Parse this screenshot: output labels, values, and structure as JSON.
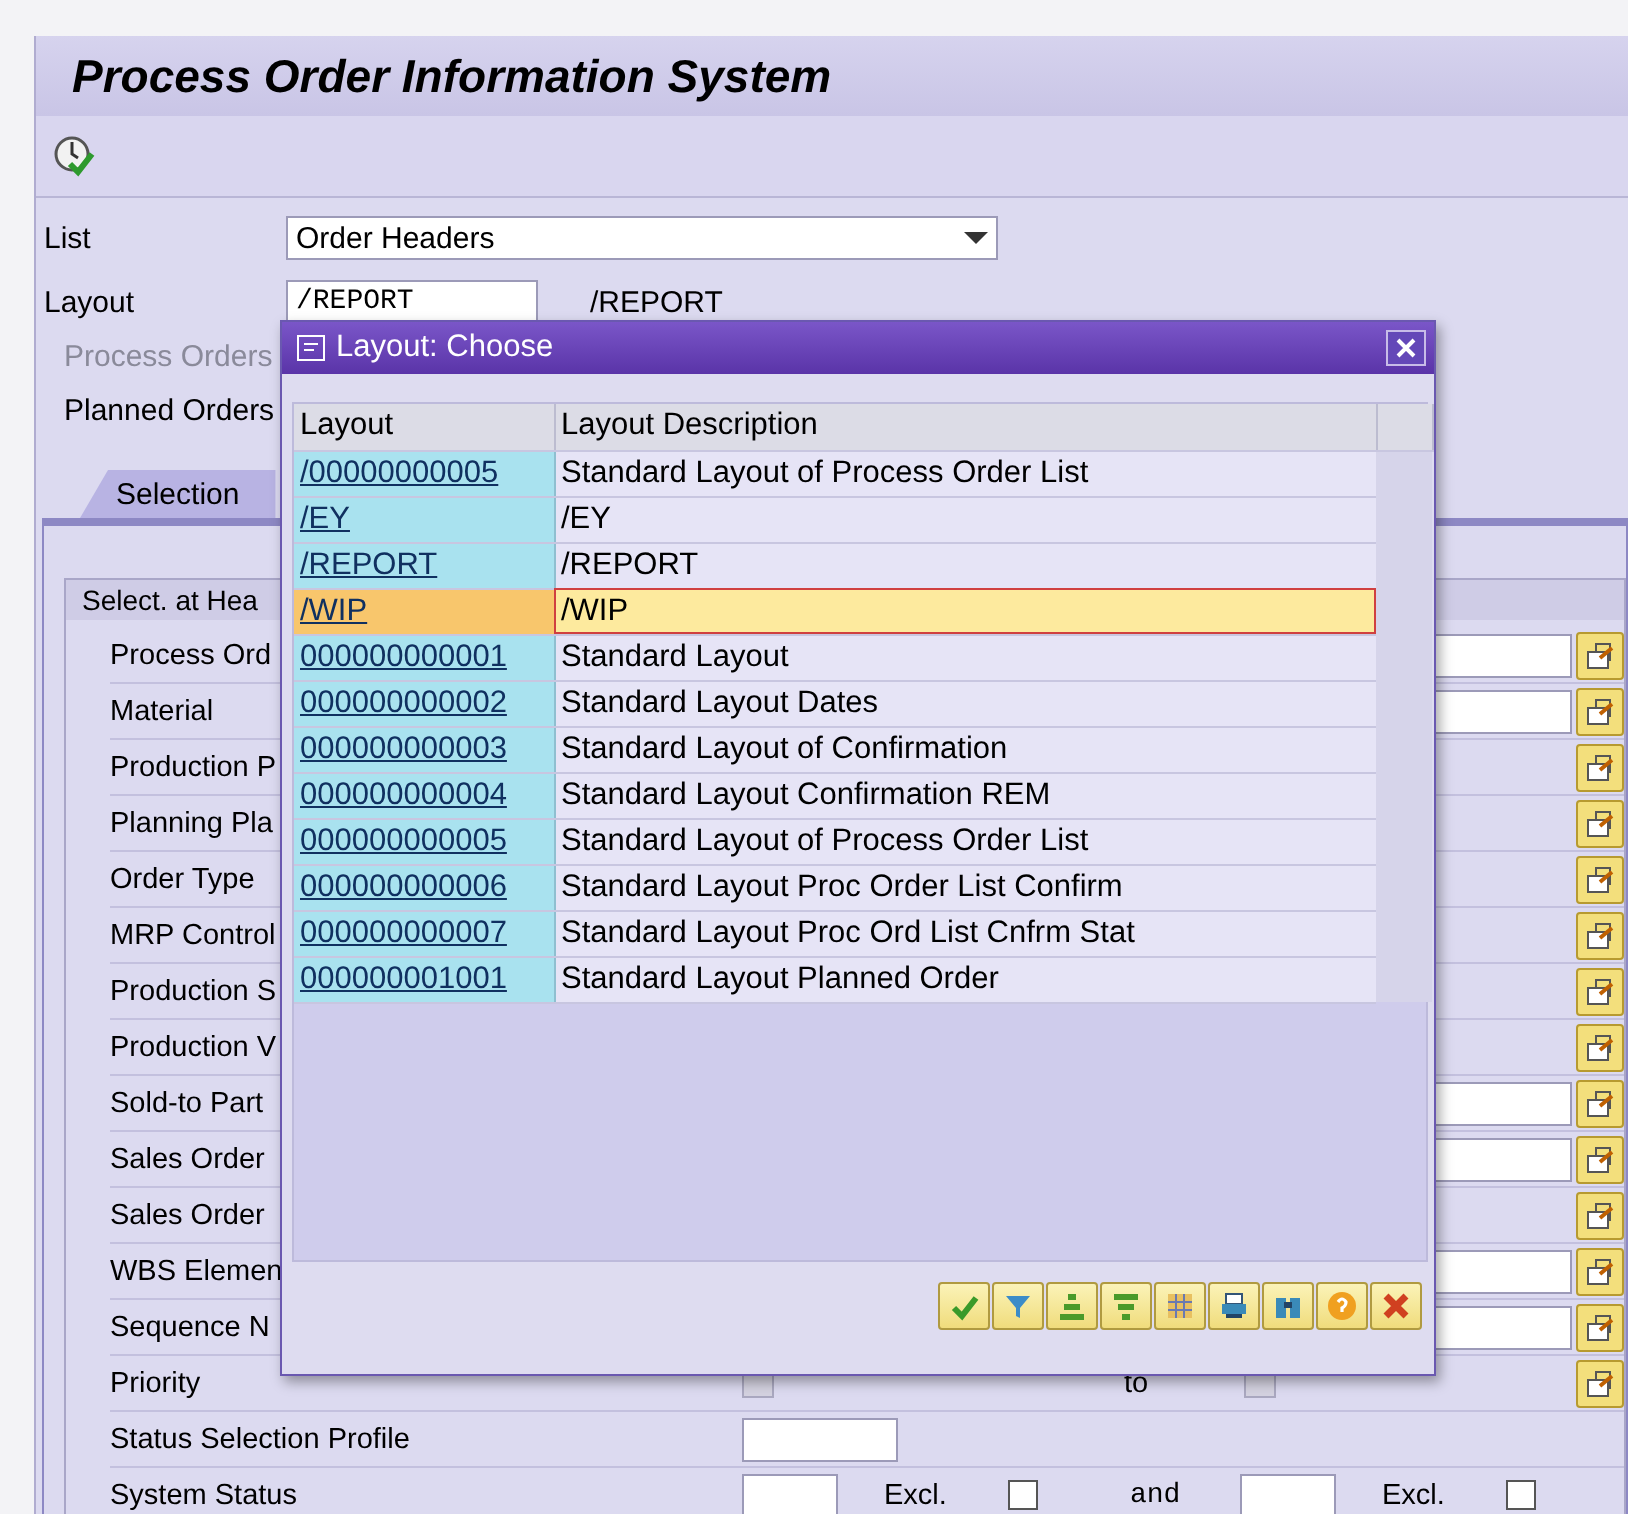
{
  "window": {
    "title": "Process Order Information System"
  },
  "form": {
    "list_label": "List",
    "list_value": "Order Headers",
    "layout_label": "Layout",
    "layout_value": "/REPORT",
    "layout_text": "/REPORT",
    "options": [
      {
        "label": "Process Orders",
        "disabled": true
      },
      {
        "label": "Planned Orders",
        "disabled": false
      }
    ]
  },
  "tabs": [
    {
      "label": "Selection",
      "selected": true
    }
  ],
  "group": {
    "title": "Select. at Hea",
    "rows": [
      {
        "label": "Process Ord",
        "kind": "range",
        "to_field": true
      },
      {
        "label": "Material",
        "kind": "range",
        "to_field": true
      },
      {
        "label": "Production P",
        "kind": "range",
        "to_field": false
      },
      {
        "label": "Planning Pla",
        "kind": "range",
        "to_field": false
      },
      {
        "label": "Order Type",
        "kind": "range",
        "to_field": false
      },
      {
        "label": "MRP Control",
        "kind": "range",
        "to_field": false
      },
      {
        "label": "Production S",
        "kind": "range",
        "to_field": false
      },
      {
        "label": "Production V",
        "kind": "range",
        "to_field": false
      },
      {
        "label": "Sold-to Part",
        "kind": "range",
        "to_field": true
      },
      {
        "label": "Sales Order",
        "kind": "range",
        "to_field": true
      },
      {
        "label": "Sales Order",
        "kind": "range",
        "to_field": false
      },
      {
        "label": "WBS Elemen",
        "kind": "range",
        "to_field": true
      },
      {
        "label": "Sequence N",
        "kind": "range",
        "to_field": true
      },
      {
        "label": "Priority",
        "kind": "priority",
        "to": "to"
      },
      {
        "label": "Status Selection Profile",
        "kind": "profile"
      },
      {
        "label": "System Status",
        "kind": "status",
        "excl1": "Excl.",
        "and": "and",
        "excl2": "Excl.",
        "excl1_checked": false,
        "excl2_checked": false
      }
    ]
  },
  "dialog": {
    "title": "Layout: Choose",
    "columns": [
      "Layout",
      "Layout Description"
    ],
    "rows": [
      {
        "layout": "/00000000005",
        "description": "Standard Layout of Process Order List",
        "selected": false
      },
      {
        "layout": "/EY",
        "description": "/EY",
        "selected": false
      },
      {
        "layout": "/REPORT",
        "description": "/REPORT",
        "selected": false
      },
      {
        "layout": "/WIP",
        "description": "/WIP",
        "selected": true
      },
      {
        "layout": "000000000001",
        "description": "Standard Layout",
        "selected": false
      },
      {
        "layout": "000000000002",
        "description": "Standard Layout Dates",
        "selected": false
      },
      {
        "layout": "000000000003",
        "description": "Standard Layout of Confirmation",
        "selected": false
      },
      {
        "layout": "000000000004",
        "description": "Standard Layout Confirmation REM",
        "selected": false
      },
      {
        "layout": "000000000005",
        "description": "Standard Layout of Process Order List",
        "selected": false
      },
      {
        "layout": "000000000006",
        "description": "Standard Layout Proc Order List Confirm",
        "selected": false
      },
      {
        "layout": "000000000007",
        "description": "Standard Layout Proc Ord List Cnfrm Stat",
        "selected": false
      },
      {
        "layout": "000000001001",
        "description": "Standard Layout Planned Order",
        "selected": false
      }
    ]
  }
}
